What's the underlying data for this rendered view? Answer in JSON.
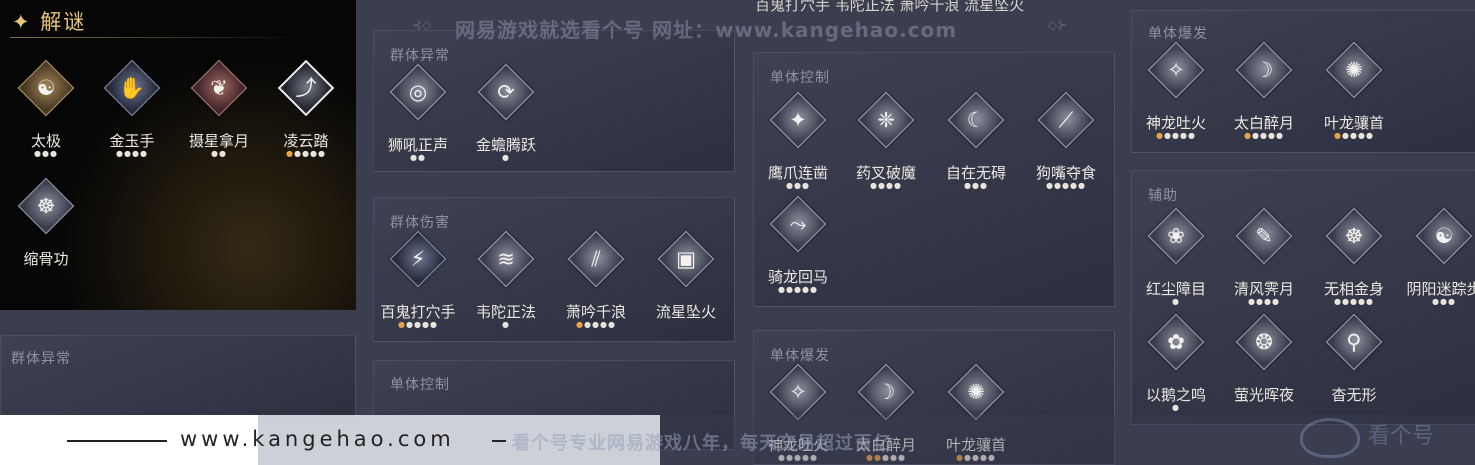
{
  "main_title": "解谜",
  "watermark_top": "网易游戏就选看个号  网址：www.kangehao.com",
  "footer": {
    "domain": "www.kangehao.com",
    "tagline": "看个号专业网易游戏八年，每天交易超过百亿",
    "corner_text": "看个号"
  },
  "top_cut_row": {
    "text": "百鬼打穴手  韦陀正法  萧吟千浪  流星坠火"
  },
  "panels": {
    "puzzle": {
      "skills": [
        {
          "name": "太极",
          "stars": 3,
          "lit": 0,
          "glyph": "☯"
        },
        {
          "name": "金玉手",
          "stars": 4,
          "lit": 0,
          "glyph": "✋"
        },
        {
          "name": "摄星拿月",
          "stars": 2,
          "lit": 0,
          "glyph": "❦"
        },
        {
          "name": "凌云踏",
          "stars": 5,
          "lit": 1,
          "glyph": "⤴"
        },
        {
          "name": "缩骨功",
          "stars": 0,
          "lit": 0,
          "glyph": "☸"
        }
      ]
    },
    "left_group_abnormal": {
      "title": "群体异常"
    },
    "group_abnormal": {
      "title": "群体异常",
      "skills": [
        {
          "name": "狮吼正声",
          "stars": 2,
          "lit": 0,
          "glyph": "◎"
        },
        {
          "name": "金蟾腾跃",
          "stars": 1,
          "lit": 0,
          "glyph": "⟳"
        }
      ]
    },
    "group_damage": {
      "title": "群体伤害",
      "skills": [
        {
          "name": "百鬼打穴手",
          "stars": 5,
          "lit": 1,
          "glyph": "⚡"
        },
        {
          "name": "韦陀正法",
          "stars": 1,
          "lit": 0,
          "glyph": "≋"
        },
        {
          "name": "萧吟千浪",
          "stars": 5,
          "lit": 1,
          "glyph": "⫽"
        },
        {
          "name": "流星坠火",
          "stars": 0,
          "lit": 0,
          "glyph": "▣"
        }
      ]
    },
    "single_control_lower": {
      "title": "单体控制"
    },
    "single_control": {
      "title": "单体控制",
      "skills": [
        {
          "name": "鹰爪连凿",
          "stars": 3,
          "lit": 0,
          "glyph": "✦"
        },
        {
          "name": "药叉破魔",
          "stars": 4,
          "lit": 0,
          "glyph": "❈"
        },
        {
          "name": "自在无碍",
          "stars": 3,
          "lit": 0,
          "glyph": "☾"
        },
        {
          "name": "狗嘴夺食",
          "stars": 5,
          "lit": 0,
          "glyph": "⟋"
        },
        {
          "name": "骑龙回马",
          "stars": 5,
          "lit": 0,
          "glyph": "⤳"
        }
      ]
    },
    "single_burst_mid": {
      "title": "单体爆发",
      "skills": [
        {
          "name": "神龙吐火",
          "stars": 5,
          "lit": 0,
          "glyph": "✧"
        },
        {
          "name": "太白醉月",
          "stars": 5,
          "lit": 2,
          "glyph": "☽"
        },
        {
          "name": "叶龙骧首",
          "stars": 5,
          "lit": 1,
          "glyph": "✺"
        }
      ]
    },
    "single_burst_right": {
      "title": "单体爆发",
      "skills": [
        {
          "name": "神龙吐火",
          "stars": 5,
          "lit": 1,
          "glyph": "✧"
        },
        {
          "name": "太白醉月",
          "stars": 5,
          "lit": 1,
          "glyph": "☽"
        },
        {
          "name": "叶龙骧首",
          "stars": 5,
          "lit": 1,
          "glyph": "✺"
        }
      ]
    },
    "support": {
      "title": "辅助",
      "skills": [
        {
          "name": "红尘障目",
          "stars": 1,
          "lit": 0,
          "glyph": "❀"
        },
        {
          "name": "清风霁月",
          "stars": 4,
          "lit": 0,
          "glyph": "✎"
        },
        {
          "name": "无相金身",
          "stars": 5,
          "lit": 0,
          "glyph": "☸"
        },
        {
          "name": "阴阳迷踪步",
          "stars": 3,
          "lit": 0,
          "glyph": "☯"
        },
        {
          "name": "以鹅之鸣",
          "stars": 1,
          "lit": 0,
          "glyph": "✿"
        },
        {
          "name": "萤光晖夜",
          "stars": 0,
          "lit": 0,
          "glyph": "❂"
        },
        {
          "name": "杳无形",
          "stars": 0,
          "lit": 0,
          "glyph": "⚲"
        }
      ]
    }
  },
  "colors": {
    "accent_gold": "#e9c57a",
    "star_lit": "#e8a24a",
    "panel_bg": "#3a3e4f",
    "panel_title": "#8e92a4"
  }
}
